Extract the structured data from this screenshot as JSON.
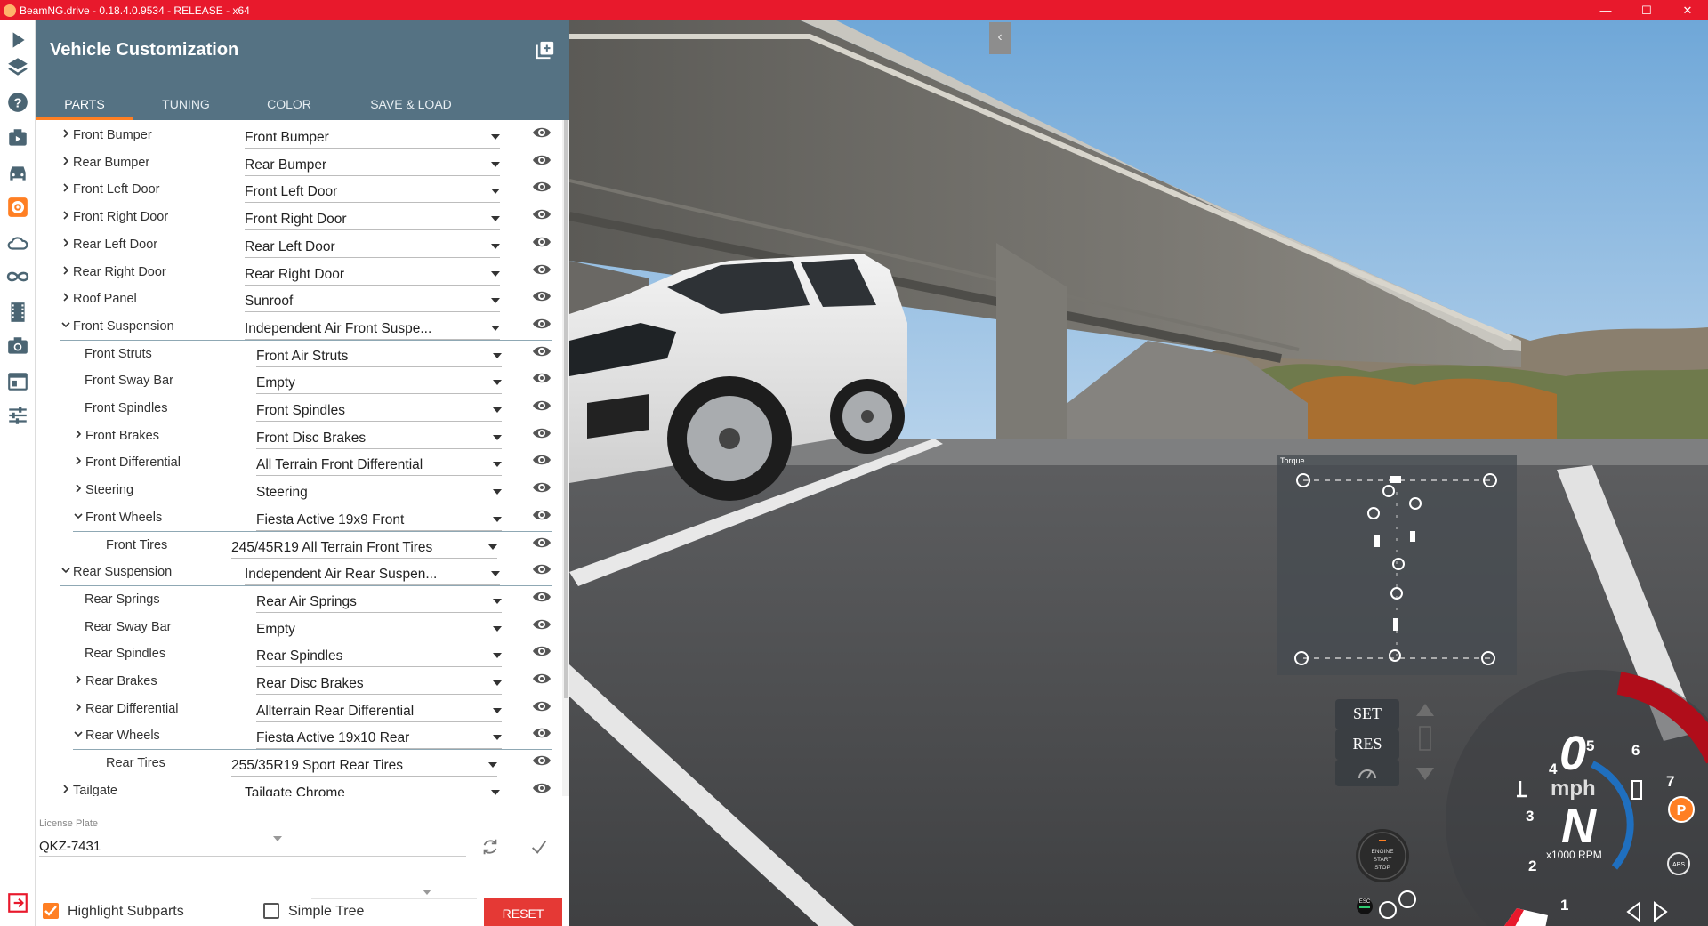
{
  "window": {
    "title": "BeamNG.drive - 0.18.4.0.9534 - RELEASE - x64",
    "minimize": "—",
    "maximize": "☐",
    "close": "✕"
  },
  "panel": {
    "title": "Vehicle Customization",
    "tabs": [
      {
        "label": "PARTS",
        "active": true
      },
      {
        "label": "TUNING",
        "active": false
      },
      {
        "label": "COLOR",
        "active": false
      },
      {
        "label": "SAVE & LOAD",
        "active": false
      }
    ],
    "parts": [
      {
        "label": "Front Bumper",
        "value": "Front Bumper",
        "level": 0,
        "expander": "collapsed"
      },
      {
        "label": "Rear Bumper",
        "value": "Rear Bumper",
        "level": 0,
        "expander": "collapsed"
      },
      {
        "label": "Front Left Door",
        "value": "Front Left Door",
        "level": 0,
        "expander": "collapsed"
      },
      {
        "label": "Front Right Door",
        "value": "Front Right Door",
        "level": 0,
        "expander": "collapsed"
      },
      {
        "label": "Rear Left Door",
        "value": "Rear Left Door",
        "level": 0,
        "expander": "collapsed"
      },
      {
        "label": "Rear Right Door",
        "value": "Rear Right Door",
        "level": 0,
        "expander": "collapsed"
      },
      {
        "label": "Roof Panel",
        "value": "Sunroof",
        "level": 0,
        "expander": "collapsed"
      },
      {
        "label": "Front Suspension",
        "value": "Independent Air Front Suspe...",
        "level": 0,
        "expander": "expanded"
      },
      {
        "label": "Front Struts",
        "value": "Front Air Struts",
        "level": 1,
        "expander": "none"
      },
      {
        "label": "Front Sway Bar",
        "value": "Empty",
        "level": 1,
        "expander": "none"
      },
      {
        "label": "Front Spindles",
        "value": "Front Spindles",
        "level": 1,
        "expander": "none"
      },
      {
        "label": "Front Brakes",
        "value": "Front Disc Brakes",
        "level": 1,
        "expander": "collapsed"
      },
      {
        "label": "Front Differential",
        "value": "All Terrain Front Differential",
        "level": 1,
        "expander": "collapsed"
      },
      {
        "label": "Steering",
        "value": "Steering",
        "level": 1,
        "expander": "collapsed"
      },
      {
        "label": "Front Wheels",
        "value": "Fiesta Active 19x9 Front",
        "level": 1,
        "expander": "expanded"
      },
      {
        "label": "Front Tires",
        "value": "245/45R19 All Terrain Front Tires",
        "level": 2,
        "expander": "none"
      },
      {
        "label": "Rear Suspension",
        "value": "Independent Air Rear Suspen...",
        "level": 0,
        "expander": "expanded"
      },
      {
        "label": "Rear Springs",
        "value": "Rear Air Springs",
        "level": 1,
        "expander": "none"
      },
      {
        "label": "Rear Sway Bar",
        "value": "Empty",
        "level": 1,
        "expander": "none"
      },
      {
        "label": "Rear Spindles",
        "value": "Rear Spindles",
        "level": 1,
        "expander": "none"
      },
      {
        "label": "Rear Brakes",
        "value": "Rear Disc Brakes",
        "level": 1,
        "expander": "collapsed"
      },
      {
        "label": "Rear Differential",
        "value": "Allterrain Rear Differential",
        "level": 1,
        "expander": "collapsed"
      },
      {
        "label": "Rear Wheels",
        "value": "Fiesta Active 19x10 Rear",
        "level": 1,
        "expander": "expanded"
      },
      {
        "label": "Rear Tires",
        "value": "255/35R19 Sport Rear Tires",
        "level": 2,
        "expander": "none"
      },
      {
        "label": "Tailgate",
        "value": "Tailgate Chrome",
        "level": 0,
        "expander": "collapsed"
      }
    ],
    "license_plate": {
      "label": "License Plate",
      "value": "QKZ-7431"
    },
    "highlight_subparts": {
      "label": "Highlight Subparts",
      "checked": true
    },
    "simple_tree": {
      "label": "Simple Tree",
      "checked": false
    },
    "reset_label": "RESET"
  },
  "hud": {
    "torque_title": "Torque",
    "cruise": {
      "set": "SET",
      "res": "RES"
    },
    "engine_button": [
      "ENGINE",
      "START",
      "STOP"
    ],
    "esc_label": "ESC",
    "speed": "0",
    "speed_unit": "mph",
    "gear": "N",
    "rpm_label": "x1000 RPM",
    "rpm_ticks": [
      "1",
      "2",
      "3",
      "4",
      "5",
      "6",
      "7"
    ],
    "park_label": "P",
    "abs_label": "ABS"
  },
  "colors": {
    "titlebar": "#e8192c",
    "panel_header": "#557283",
    "accent": "#ff7f23",
    "reset": "#e53935"
  }
}
